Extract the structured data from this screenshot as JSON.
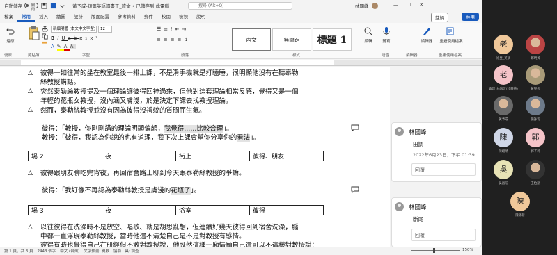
{
  "titlebar": {
    "autosave_label": "自動儲存",
    "autosave_state": "關閉",
    "doc_title": "黃予成-短篇英語讀書王_旅文 • 已儲存到 此電腦",
    "search_placeholder": "搜尋 (Alt+Q)",
    "user_name": "林國峰",
    "min_glyph": "—",
    "max_glyph": "☐",
    "close_glyph": "✕"
  },
  "ribbon_tabs": [
    "檔案",
    "常用",
    "插入",
    "繪圖",
    "設計",
    "版面配置",
    "參考資料",
    "郵件",
    "校閱",
    "檢視",
    "說明"
  ],
  "active_tab": "常用",
  "buttons": {
    "comments": "註解",
    "share": "共用"
  },
  "font": {
    "name": "新細明體 (本文中文字型)",
    "size": "12"
  },
  "styles": [
    "內文",
    "無間距",
    "標題 1"
  ],
  "groups": {
    "clipboard": "剪貼簿",
    "font": "字型",
    "paragraph": "段落",
    "styles": "樣式",
    "undo": "復原",
    "voice": "語音",
    "editor": "編輯器",
    "reuse": "重複使用檔案",
    "edit_big": "編輯",
    "dictate": "聽寫",
    "reuse_big": "重複使用檔案",
    "undo_big": "還原"
  },
  "document": {
    "p1_line1": "彼得一如往常的坐在教室最後一排上課，不是滑手機就是打瞌睡，很明顯他沒有在聽泰勒",
    "p1_line2": "絲教授講話。",
    "p2_line1": "突然泰勒絲教授提及一個理論讓彼得回神過來，但他對這套理論相當反感，覺得又是一個",
    "p2_line2": "年輕的花瓶女教授，沒內涵又膚淺，於是決定下課去找教授理論。",
    "p3": "然而，泰勒絲教授並沒有因為彼得沒禮貌的質問而生氣。",
    "dlg1_prefix": "彼得：「教授，你剛剛講的理論明顯偏頗，",
    "dlg1_mark": "我覺得......比較合理",
    "dlg1_suffix": "」。",
    "dlg2_prefix": "教授：「彼得，我認為你說的也有道理，我下次上課會幫你分享你的",
    "dlg2_mark": "看法",
    "dlg2_suffix": "」。",
    "scene2": [
      "場 2",
      "夜",
      "街上",
      "彼得、朋友"
    ],
    "p4": "彼得跟朋友聊吃完宵夜，再回宿舍路上聊到今天跟泰勒絲教授的爭論。",
    "dlg3_prefix": "彼得：「我好像不再認為泰勒絲教授是膚淺的",
    "dlg3_mark": "花瓶了",
    "dlg3_suffix": "」。",
    "scene3": [
      "場 3",
      "夜",
      "浴室",
      "彼得"
    ],
    "p5_line1": "以往彼得在洗澡時不是放空、唱歌、就是胡思亂想，但連續好幾天彼得回到宿舍洗澡，腦",
    "p5_line2": "中都一直浮現泰勒絲教授，當時他還不清楚自己是不是對教授有感情。",
    "p5_line3": "彼得有時也覺得自己在研經但不敢對教授說，他既然這樣一廂情願自己還可以不這樣對教授說："
  },
  "comments": [
    {
      "author": "林國峰",
      "text": "田調",
      "date": "2022年6月23日，下午 01:39",
      "reply": "回覆"
    },
    {
      "author": "林國峰",
      "text": "斷尾",
      "reply": "回覆"
    }
  ],
  "status": {
    "page": "第 1 頁，共 3 頁",
    "words": "2443 個字",
    "lang": "中文 (台灣)",
    "predict": "文字預測: 開啟",
    "accessibility": "協助工具: 調查",
    "zoom": "150%"
  },
  "participants": [
    {
      "name": "徐旻_英碩",
      "avatar": "老",
      "color": "#f0c89a"
    },
    {
      "name": "鄭明黃",
      "avatar": "",
      "color": "#b44"
    },
    {
      "name": "會理_林瑞沂(冷壽德)",
      "avatar": "老",
      "color": "#f4c3c8"
    },
    {
      "name": "黃聖修",
      "avatar": "",
      "color": "#a89a78"
    },
    {
      "name": "黃予成",
      "avatar": "",
      "color": "#6a6a6a"
    },
    {
      "name": "施詠羽",
      "avatar": "",
      "color": "#6d7a8a"
    },
    {
      "name": "陳翊晴",
      "avatar": "陳",
      "color": "#cfd6e6"
    },
    {
      "name": "郭子玲",
      "avatar": "郭",
      "color": "#f4c3c8"
    },
    {
      "name": "吳昌暄",
      "avatar": "吳",
      "color": "#e8e3b6"
    },
    {
      "name": "王柏勛",
      "avatar": "",
      "color": "#333"
    },
    {
      "name": "陳錦耕",
      "avatar": "陳",
      "color": "#f0c89a"
    }
  ]
}
